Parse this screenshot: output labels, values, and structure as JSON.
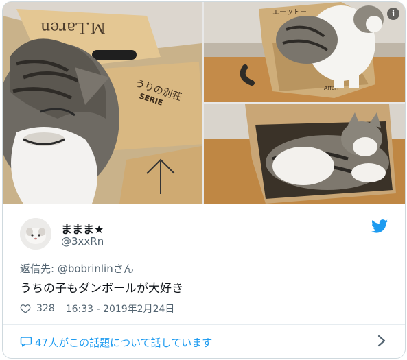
{
  "tweet": {
    "display_name": "ままま★",
    "handle": "@3xxRn",
    "reply_to_prefix": "返信先: ",
    "reply_to_user": "@bobrinlinさん",
    "text": "うちの子もダンボールが大好き",
    "like_count": "328",
    "timestamp": "16:33 - 2019年2月24日",
    "conversation_text": "47人がこの話題について話しています"
  },
  "media": {
    "info_icon_label": "i",
    "box_left_text_1": "M.Laren",
    "box_left_text_2": "うりの別荘",
    "box_left_text_3": "SERIE",
    "box_tr_text": "エーットー",
    "box_br_text": "Affari"
  },
  "icons": {
    "verified_bird": "twitter-bird-icon",
    "like": "heart-icon",
    "conversation": "chat-bubble-icon",
    "more": "chevron-right-icon",
    "info": "info-icon"
  },
  "colors": {
    "accent": "#1d9bf0",
    "text": "#0f1419",
    "muted": "#536471",
    "border": "#cfd9de"
  }
}
